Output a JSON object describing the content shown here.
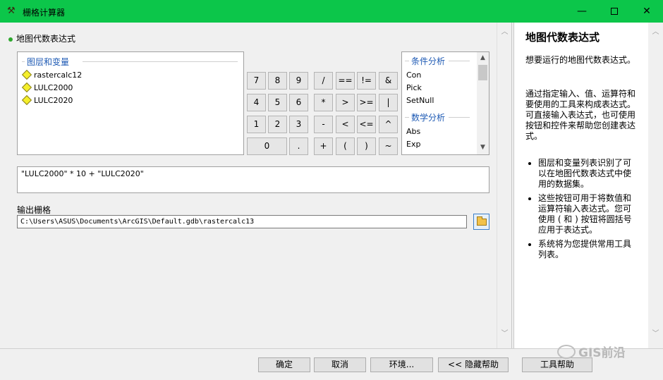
{
  "window": {
    "title": "栅格计算器",
    "minimize": "—",
    "close": "✕"
  },
  "section": {
    "heading": "地图代数表达式"
  },
  "layers": {
    "group_title": "图层和变量",
    "items": [
      "rastercalc12",
      "LULC2000",
      "LULC2020"
    ]
  },
  "keypad": {
    "buttons": [
      "7",
      "8",
      "9",
      "/",
      "==",
      "!=",
      "&",
      "4",
      "5",
      "6",
      "*",
      ">",
      ">=",
      "|",
      "1",
      "2",
      "3",
      "-",
      "<",
      "<=",
      "^",
      "0",
      ".",
      "+",
      "(",
      ")",
      "~"
    ]
  },
  "functions": {
    "groups": [
      {
        "title": "条件分析",
        "items": [
          "Con",
          "Pick",
          "SetNull"
        ]
      },
      {
        "title": "数学分析",
        "items": [
          "Abs",
          "Exp"
        ]
      }
    ]
  },
  "expression": {
    "value": "\"LULC2000\" * 10 + \"LULC2020\""
  },
  "output": {
    "label": "输出栅格",
    "value": "C:\\Users\\ASUS\\Documents\\ArcGIS\\Default.gdb\\rastercalc13"
  },
  "help": {
    "title": "地图代数表达式",
    "p1": "想要运行的地图代数表达式。",
    "p2": "通过指定输入、值、运算符和要使用的工具来构成表达式。可直接输入表达式，也可使用按钮和控件来帮助您创建表达式。",
    "bullets": [
      "图层和变量列表识别了可以在地图代数表达式中使用的数据集。",
      "这些按钮可用于将数值和运算符输入表达式。您可使用 ( 和 ) 按钮将圆括号应用于表达式。",
      "系统将为您提供常用工具列表。"
    ]
  },
  "footer": {
    "ok": "确定",
    "cancel": "取消",
    "env": "环境...",
    "hide_help": "<< 隐藏帮助",
    "tool_help": "工具帮助"
  },
  "watermark": "GIS前沿"
}
